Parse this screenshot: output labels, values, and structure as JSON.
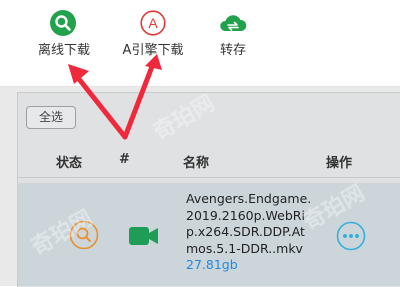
{
  "toolbar": {
    "offline": {
      "label": "离线下载",
      "icon": "offline-download-search-icon",
      "color": "#23a24d"
    },
    "aria": {
      "label": "A引擎下载",
      "icon": "aria-engine-icon",
      "glyph": "A",
      "color": "#e53935"
    },
    "save": {
      "label": "转存",
      "icon": "cloud-transfer-icon",
      "color": "#23a24d"
    }
  },
  "list": {
    "select_all": "全选",
    "columns": {
      "status": "状态",
      "index": "#",
      "name": "名称",
      "actions": "操作"
    },
    "rows": [
      {
        "status_icon": "magnifier-status-icon",
        "type_icon": "video-icon",
        "name": "Avengers.Endgame.2019.2160p.WebRip.x264.SDR.DDP.Atmos.5.1-DDR..mkv",
        "size": "27.81gb",
        "action_icon": "more-icon"
      }
    ]
  },
  "watermark": "奇珀网",
  "colors": {
    "arrow": "#f0283c",
    "size_text": "#1e88e5",
    "status_ring": "#e8902a",
    "more_ring": "#35b0d8",
    "video": "#1f9d57"
  }
}
